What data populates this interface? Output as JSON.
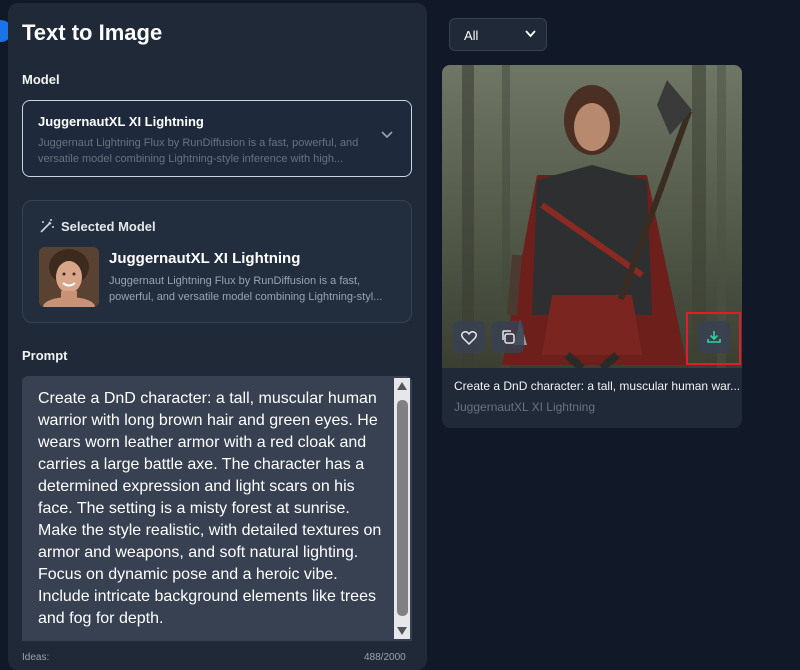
{
  "page": {
    "title": "Text to Image"
  },
  "model_section": {
    "label": "Model",
    "selected_name": "JuggernautXL XI Lightning",
    "selected_desc": "Juggernaut Lightning Flux by RunDiffusion is a fast, powerful, and versatile model combining Lightning-style inference with high..."
  },
  "selected_model_card": {
    "heading": "Selected Model",
    "name": "JuggernautXL XI Lightning",
    "desc": "Juggernaut Lightning Flux by RunDiffusion is a fast, powerful, and versatile model combining Lightning-styl..."
  },
  "prompt": {
    "label": "Prompt",
    "value": "Create a DnD character: a tall, muscular human warrior with long brown hair and green eyes. He wears worn leather armor with a red cloak and carries a large battle axe. The character has a determined expression and light scars on his face. The setting is a misty forest at sunrise. Make the style realistic, with detailed textures on armor and weapons, and soft natural lighting. Focus on dynamic pose and a heroic vibe. Include intricate background elements like trees and fog for depth.",
    "ideas_label": "Ideas:",
    "char_count": "488/2000"
  },
  "gallery": {
    "filter_value": "All",
    "items": [
      {
        "caption": "Create a DnD character: a tall, muscular human war...",
        "model": "JuggernautXL XI Lightning"
      }
    ]
  },
  "icons": {
    "favorite": "heart-icon",
    "copy": "copy-icon",
    "download": "download-icon",
    "wand": "magic-wand-icon",
    "chevron": "chevron-down-icon"
  },
  "colors": {
    "accent": "#1a73e8",
    "download_icon": "#34d399",
    "highlight": "#e11d2a"
  }
}
